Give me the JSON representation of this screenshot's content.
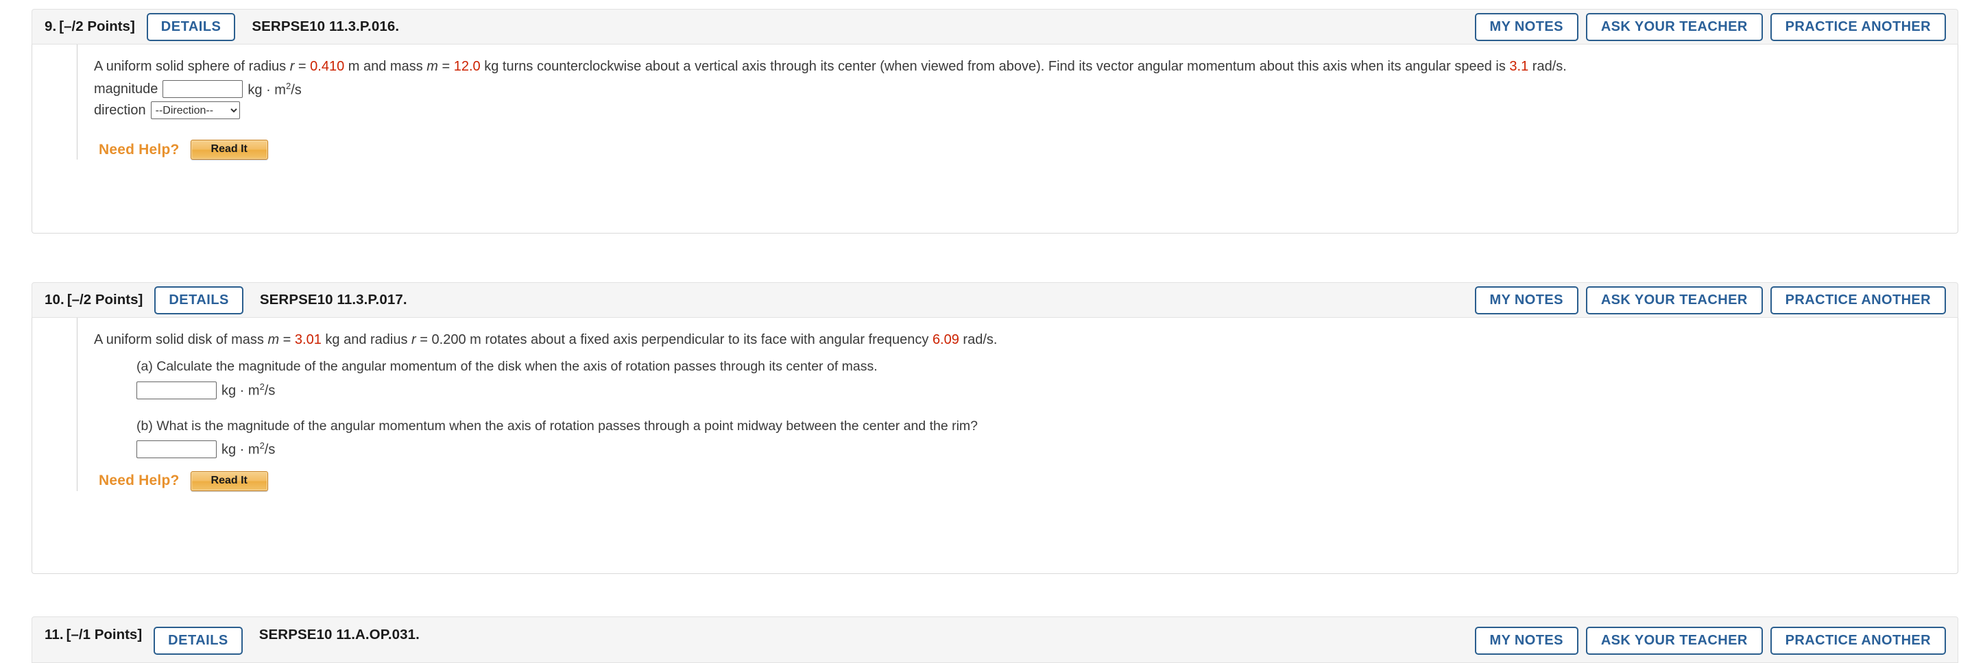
{
  "colors": {
    "accent_blue": "#2a6099",
    "border_blue": "#2a5e8e",
    "value_red": "#cc2200",
    "need_help_orange": "#e8912d",
    "header_bg": "#f5f5f5"
  },
  "actions": {
    "details": "DETAILS",
    "my_notes": "MY NOTES",
    "ask_your_teacher": "ASK YOUR TEACHER",
    "practice_another": "PRACTICE ANOTHER",
    "need_help_label": "Need Help?",
    "read_it": "Read It"
  },
  "problems": [
    {
      "number": "9.",
      "points": "[–/2 Points]",
      "code": "SERPSE10 11.3.P.016.",
      "question": {
        "s1": "A uniform solid sphere of radius ",
        "v1": "r",
        "s2": " = ",
        "n1": "0.410",
        "s3": " m and mass ",
        "v2": "m",
        "s4": " = ",
        "n2": "12.0",
        "s5": " kg turns counterclockwise about a vertical axis through its center (when viewed from above). Find its vector angular momentum about this axis when its angular speed is ",
        "n3": "3.1",
        "s6": " rad/s."
      },
      "magnitude_label": "magnitude",
      "magnitude_value": "",
      "magnitude_units_pre": "kg · m",
      "magnitude_units_sup": "2",
      "magnitude_units_post": "/s",
      "direction_label": "direction",
      "direction_selected": "--Direction--",
      "direction_options": [
        "--Direction--"
      ]
    },
    {
      "number": "10.",
      "points": "[–/2 Points]",
      "code": "SERPSE10 11.3.P.017.",
      "question": {
        "s1": "A uniform solid disk of mass ",
        "v1": "m",
        "s2": " = ",
        "n1": "3.01",
        "s3": " kg and radius ",
        "v2": "r",
        "s4": " = 0.200 m rotates about a fixed axis perpendicular to its face with angular frequency ",
        "n2": "6.09",
        "s5": " rad/s."
      },
      "parts": [
        {
          "text": "(a) Calculate the magnitude of the angular momentum of the disk when the axis of rotation passes through its center of mass.",
          "value": "",
          "units_pre": "kg · m",
          "units_sup": "2",
          "units_post": "/s"
        },
        {
          "text": "(b) What is the magnitude of the angular momentum when the axis of rotation passes through a point midway between the center and the rim?",
          "value": "",
          "units_pre": "kg · m",
          "units_sup": "2",
          "units_post": "/s"
        }
      ]
    },
    {
      "number": "11.",
      "points": "[–/1 Points]",
      "code": "SERPSE10 11.A.OP.031."
    }
  ]
}
